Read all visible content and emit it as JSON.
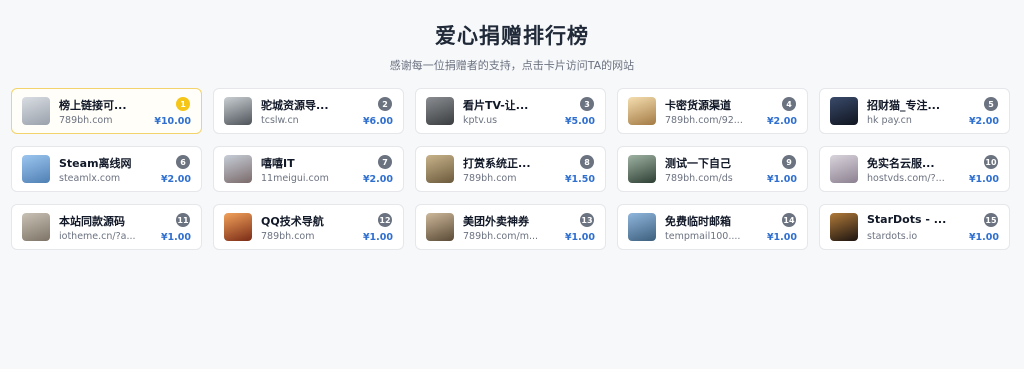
{
  "page": {
    "title": "爱心捐赠排行榜",
    "subtitle": "感谢每一位捐赠者的支持，点击卡片访问TA的网站"
  },
  "donors": [
    {
      "rank": "1",
      "name": "榜上链接可...",
      "url": "789bh.com",
      "amount": "¥10.00",
      "thumb": "thumb-building-icon",
      "colors": [
        "#d9dde3",
        "#9aa1ab"
      ]
    },
    {
      "rank": "2",
      "name": "驼城资源导...",
      "url": "tcslw.cn",
      "amount": "¥6.00",
      "thumb": "thumb-street-icon",
      "colors": [
        "#c9cfd3",
        "#4d5358"
      ]
    },
    {
      "rank": "3",
      "name": "看片TV-让...",
      "url": "kptv.us",
      "amount": "¥5.00",
      "thumb": "thumb-clouds-icon",
      "colors": [
        "#8a8d91",
        "#3a3d40"
      ]
    },
    {
      "rank": "4",
      "name": "卡密货源渠道",
      "url": "789bh.com/92...",
      "amount": "¥2.00",
      "thumb": "thumb-sunlight-icon",
      "colors": [
        "#f5deb0",
        "#a37a44"
      ]
    },
    {
      "rank": "5",
      "name": "招财猫_专注...",
      "url": "hk pay.cn",
      "amount": "¥2.00",
      "thumb": "thumb-night-city-icon",
      "colors": [
        "#3a4a6b",
        "#10151f"
      ]
    },
    {
      "rank": "6",
      "name": "Steam离线网",
      "url": "steamlx.com",
      "amount": "¥2.00",
      "thumb": "thumb-tower-icon",
      "colors": [
        "#9cc6f0",
        "#4f7fb3"
      ]
    },
    {
      "rank": "7",
      "name": "嘻嘻IT",
      "url": "11meigui.com",
      "amount": "¥2.00",
      "thumb": "thumb-city-icon",
      "colors": [
        "#c7ced8",
        "#7a6a6a"
      ]
    },
    {
      "rank": "8",
      "name": "打赏系统正...",
      "url": "789bh.com",
      "amount": "¥1.50",
      "thumb": "thumb-field-icon",
      "colors": [
        "#c8b38a",
        "#6b5a3c"
      ]
    },
    {
      "rank": "9",
      "name": "测试一下自己",
      "url": "789bh.com/ds",
      "amount": "¥1.00",
      "thumb": "thumb-valley-icon",
      "colors": [
        "#9fb3a3",
        "#2d3f33"
      ]
    },
    {
      "rank": "10",
      "name": "免实名云服...",
      "url": "hostvds.com/?...",
      "amount": "¥1.00",
      "thumb": "thumb-dusk-icon",
      "colors": [
        "#d9d4dc",
        "#8c8090"
      ]
    },
    {
      "rank": "11",
      "name": "本站同款源码",
      "url": "iotheme.cn/?a...",
      "amount": "¥1.00",
      "thumb": "thumb-bird-icon",
      "colors": [
        "#c9c2b6",
        "#7d7466"
      ]
    },
    {
      "rank": "12",
      "name": "QQ技术导航",
      "url": "789bh.com",
      "amount": "¥1.00",
      "thumb": "thumb-sunset-icon",
      "colors": [
        "#f2a25a",
        "#7a2b16"
      ]
    },
    {
      "rank": "13",
      "name": "美团外卖神券",
      "url": "789bh.com/m...",
      "amount": "¥1.00",
      "thumb": "thumb-alley-icon",
      "colors": [
        "#cdb89a",
        "#5a4a36"
      ]
    },
    {
      "rank": "14",
      "name": "免费临时邮箱",
      "url": "tempmail100....",
      "amount": "¥1.00",
      "thumb": "thumb-lake-icon",
      "colors": [
        "#8fb6dc",
        "#3d5f7d"
      ]
    },
    {
      "rank": "15",
      "name": "StarDots - ...",
      "url": "stardots.io",
      "amount": "¥1.00",
      "thumb": "thumb-lights-icon",
      "colors": [
        "#b07a3a",
        "#1c1410"
      ]
    }
  ]
}
